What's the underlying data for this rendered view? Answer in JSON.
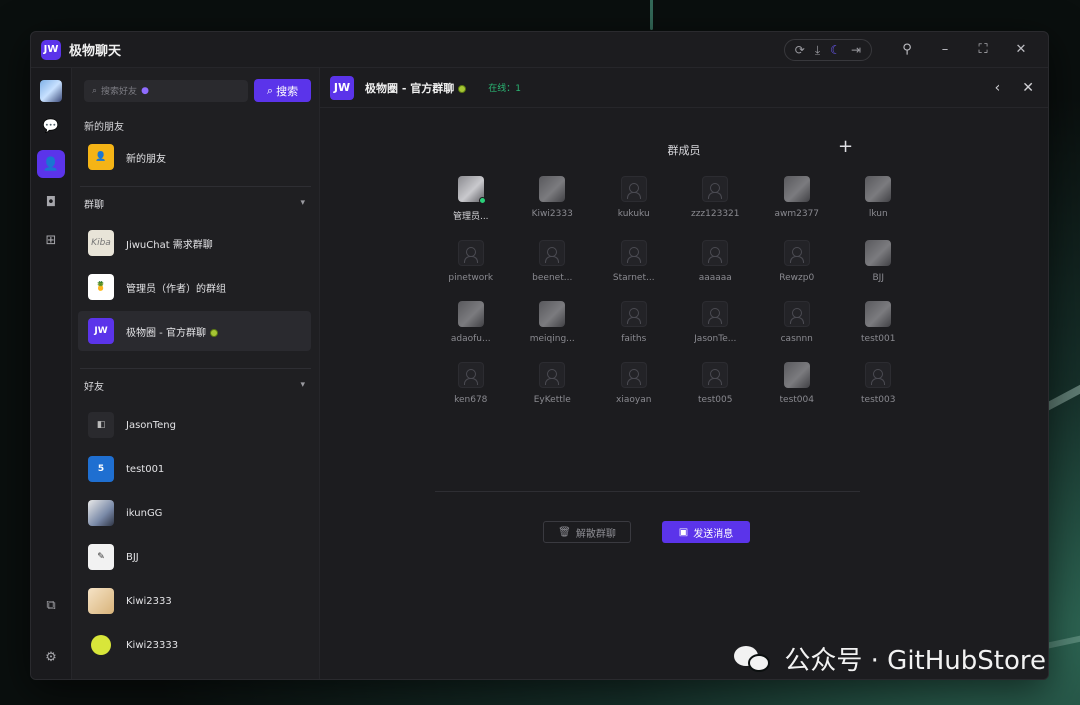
{
  "app": {
    "logo_text": "JW",
    "title": "极物聊天"
  },
  "titlebar": {
    "icons": [
      "refresh-icon",
      "download-icon",
      "moon-icon",
      "exit-icon",
      "pin-icon",
      "minimize-icon",
      "maximize-icon",
      "close-icon"
    ]
  },
  "rail": {
    "items": [
      "chat-icon",
      "contacts-icon",
      "bot-icon",
      "apps-icon"
    ],
    "bottom": [
      "device-icon",
      "settings-icon"
    ]
  },
  "sidebar": {
    "search_placeholder": "搜索好友",
    "search_button": "搜索",
    "new_friends_section": "新的朋友",
    "new_friends_item": "新的朋友",
    "groups_section": "群聊",
    "groups": [
      {
        "name": "JiwuChat 需求群聊",
        "avatar_text": "Kiba"
      },
      {
        "name": "管理员（作者）的群组",
        "avatar_text": "🍍"
      },
      {
        "name": "极物圈 - 官方群聊",
        "avatar_text": "JW"
      }
    ],
    "friends_section": "好友",
    "friends": [
      {
        "name": "JasonTeng"
      },
      {
        "name": "test001",
        "avatar_text": "5"
      },
      {
        "name": "ikunGG"
      },
      {
        "name": "BJJ"
      },
      {
        "name": "Kiwi2333"
      },
      {
        "name": "Kiwi23333"
      }
    ]
  },
  "main": {
    "logo_text": "JW",
    "title": "极物圈 - 官方群聊",
    "online_label": "在线：",
    "online_count": "1",
    "members_title": "群成员",
    "add_icon": "+",
    "members": [
      {
        "name": "管理员...",
        "avatar": "img",
        "online": true
      },
      {
        "name": "Kiwi2333",
        "avatar": "img"
      },
      {
        "name": "kukuku",
        "avatar": "ph"
      },
      {
        "name": "zzz123321",
        "avatar": "ph"
      },
      {
        "name": "awm2377",
        "avatar": "img"
      },
      {
        "name": "lkun",
        "avatar": "img"
      },
      {
        "name": "pinetwork",
        "avatar": "ph"
      },
      {
        "name": "beenet...",
        "avatar": "ph"
      },
      {
        "name": "Starnet...",
        "avatar": "ph"
      },
      {
        "name": "aaaaaa",
        "avatar": "ph"
      },
      {
        "name": "Rewzp0",
        "avatar": "ph"
      },
      {
        "name": "BJJ",
        "avatar": "img"
      },
      {
        "name": "adaofu...",
        "avatar": "img"
      },
      {
        "name": "meiqing...",
        "avatar": "img"
      },
      {
        "name": "faiths",
        "avatar": "ph"
      },
      {
        "name": "JasonTe...",
        "avatar": "ph"
      },
      {
        "name": "casnnn",
        "avatar": "ph"
      },
      {
        "name": "test001",
        "avatar": "img"
      },
      {
        "name": "ken678",
        "avatar": "ph"
      },
      {
        "name": "EyKettle",
        "avatar": "ph"
      },
      {
        "name": "xiaoyan",
        "avatar": "ph"
      },
      {
        "name": "test005",
        "avatar": "ph"
      },
      {
        "name": "test004",
        "avatar": "img"
      },
      {
        "name": "test003",
        "avatar": "ph"
      }
    ],
    "dissolve_button": "解散群聊",
    "send_button": "发送消息"
  },
  "watermark": "公众号 · GitHubStore",
  "colors": {
    "accent": "#5b34ea",
    "online": "#2bb673",
    "background": "#1c1c1f"
  }
}
